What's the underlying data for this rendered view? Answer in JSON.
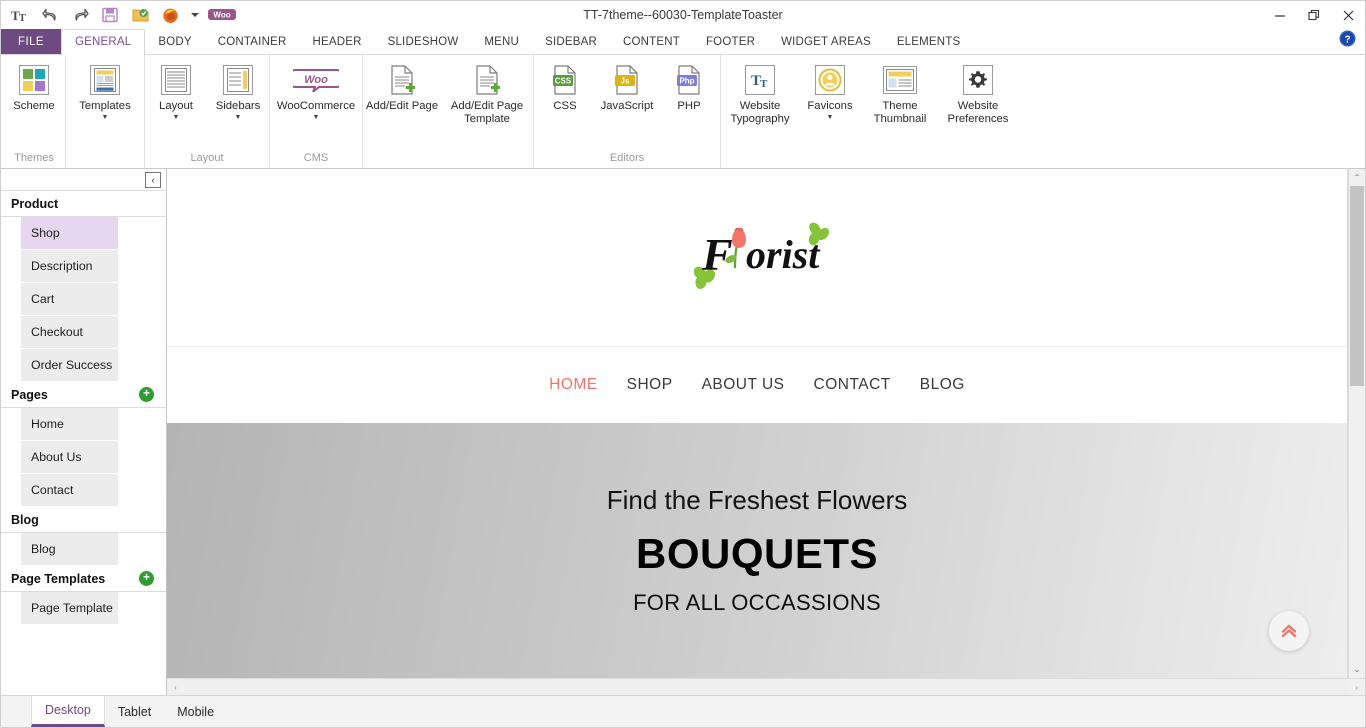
{
  "window": {
    "title": "TT-7theme--60030-TemplateToaster",
    "quick_access": [
      {
        "name": "typography-icon",
        "glyph": "Tt"
      },
      {
        "name": "undo-icon",
        "glyph": "undo"
      },
      {
        "name": "redo-icon",
        "glyph": "redo"
      },
      {
        "name": "save-icon",
        "glyph": "save"
      },
      {
        "name": "open-folder-icon",
        "glyph": "folder"
      },
      {
        "name": "firefox-preview-icon",
        "glyph": "firefox"
      },
      {
        "name": "browser-dropdown-caret",
        "glyph": "▾"
      },
      {
        "name": "woocommerce-icon",
        "glyph": "Woo"
      }
    ],
    "controls": {
      "minimize": "–",
      "restore": "❐",
      "close": "×",
      "help": "?"
    }
  },
  "ribbon": {
    "file_tab": "FILE",
    "tabs": [
      {
        "label": "GENERAL",
        "active": true
      },
      {
        "label": "BODY",
        "active": false
      },
      {
        "label": "CONTAINER",
        "active": false
      },
      {
        "label": "HEADER",
        "active": false
      },
      {
        "label": "SLIDESHOW",
        "active": false
      },
      {
        "label": "MENU",
        "active": false
      },
      {
        "label": "SIDEBAR",
        "active": false
      },
      {
        "label": "CONTENT",
        "active": false
      },
      {
        "label": "FOOTER",
        "active": false
      },
      {
        "label": "WIDGET AREAS",
        "active": false
      },
      {
        "label": "ELEMENTS",
        "active": false
      }
    ],
    "groups": [
      {
        "name": "Themes",
        "label": "Themes",
        "items": [
          {
            "label": "Scheme",
            "icon": "color-scheme-icon",
            "caret": false
          }
        ]
      },
      {
        "name": "Themes2",
        "label": "",
        "items": [
          {
            "label": "Templates",
            "icon": "templates-icon",
            "caret": true
          }
        ]
      },
      {
        "name": "Layout",
        "label": "Layout",
        "items": [
          {
            "label": "Layout",
            "icon": "layout-icon",
            "caret": true
          },
          {
            "label": "Sidebars",
            "icon": "sidebars-icon",
            "caret": true
          }
        ]
      },
      {
        "name": "CMS",
        "label": "CMS",
        "items": [
          {
            "label": "WooCommerce",
            "icon": "woocommerce-icon",
            "caret": true
          }
        ]
      },
      {
        "name": "Pages",
        "label": "",
        "items": [
          {
            "label": "Add/Edit Page",
            "icon": "add-edit-page-icon",
            "caret": false
          },
          {
            "label": "Add/Edit Page Template",
            "icon": "add-edit-page-template-icon",
            "caret": false
          }
        ]
      },
      {
        "name": "Editors",
        "label": "Editors",
        "items": [
          {
            "label": "CSS",
            "icon": "css-file-icon",
            "caret": false
          },
          {
            "label": "JavaScript",
            "icon": "js-file-icon",
            "caret": false
          },
          {
            "label": "PHP",
            "icon": "php-file-icon",
            "caret": false
          }
        ]
      },
      {
        "name": "Website",
        "label": "",
        "items": [
          {
            "label": "Website Typography",
            "icon": "typography-icon",
            "caret": false
          },
          {
            "label": "Favicons",
            "icon": "favicon-icon",
            "caret": true
          },
          {
            "label": "Theme Thumbnail",
            "icon": "theme-thumbnail-icon",
            "caret": false
          },
          {
            "label": "Website Preferences",
            "icon": "gear-icon",
            "caret": false
          }
        ]
      }
    ]
  },
  "sidebar": {
    "collapse_glyph": "‹",
    "sections": [
      {
        "name": "product",
        "title": "Product",
        "add_button": false,
        "items": [
          {
            "label": "Shop",
            "selected": true
          },
          {
            "label": "Description",
            "selected": false
          },
          {
            "label": "Cart",
            "selected": false
          },
          {
            "label": "Checkout",
            "selected": false
          },
          {
            "label": "Order Success",
            "selected": false
          }
        ]
      },
      {
        "name": "pages",
        "title": "Pages",
        "add_button": true,
        "items": [
          {
            "label": "Home",
            "selected": false
          },
          {
            "label": "About Us",
            "selected": false
          },
          {
            "label": "Contact",
            "selected": false
          }
        ]
      },
      {
        "name": "blog",
        "title": "Blog",
        "add_button": false,
        "items": [
          {
            "label": "Blog",
            "selected": false
          }
        ]
      },
      {
        "name": "page-templates",
        "title": "Page Templates",
        "add_button": true,
        "items": [
          {
            "label": "Page Template",
            "selected": false
          }
        ]
      }
    ],
    "add_glyph": "+"
  },
  "preview": {
    "logo": {
      "text": "Florist",
      "flower_color": "#f4766b",
      "leaf_color": "#86c23a"
    },
    "nav": [
      {
        "label": "HOME",
        "active": true
      },
      {
        "label": "SHOP",
        "active": false
      },
      {
        "label": "ABOUT US",
        "active": false
      },
      {
        "label": "CONTACT",
        "active": false
      },
      {
        "label": "BLOG",
        "active": false
      }
    ],
    "hero": {
      "line1": "Find the Freshest Flowers",
      "line2": "BOUQUETS",
      "line3": "FOR ALL OCCASSIONS"
    },
    "scroll_top_glyph": "»",
    "accent_color": "#f1756b"
  },
  "bottom": {
    "tabs": [
      {
        "label": "Desktop",
        "active": true
      },
      {
        "label": "Tablet",
        "active": false
      },
      {
        "label": "Mobile",
        "active": false
      }
    ]
  },
  "scrollbars": {
    "up": "⌃",
    "down": "⌄",
    "left": "‹",
    "right": "›"
  },
  "colors": {
    "brand_purple": "#6f4a82",
    "accent_salmon": "#f1756b",
    "green_add": "#2e9e33"
  }
}
